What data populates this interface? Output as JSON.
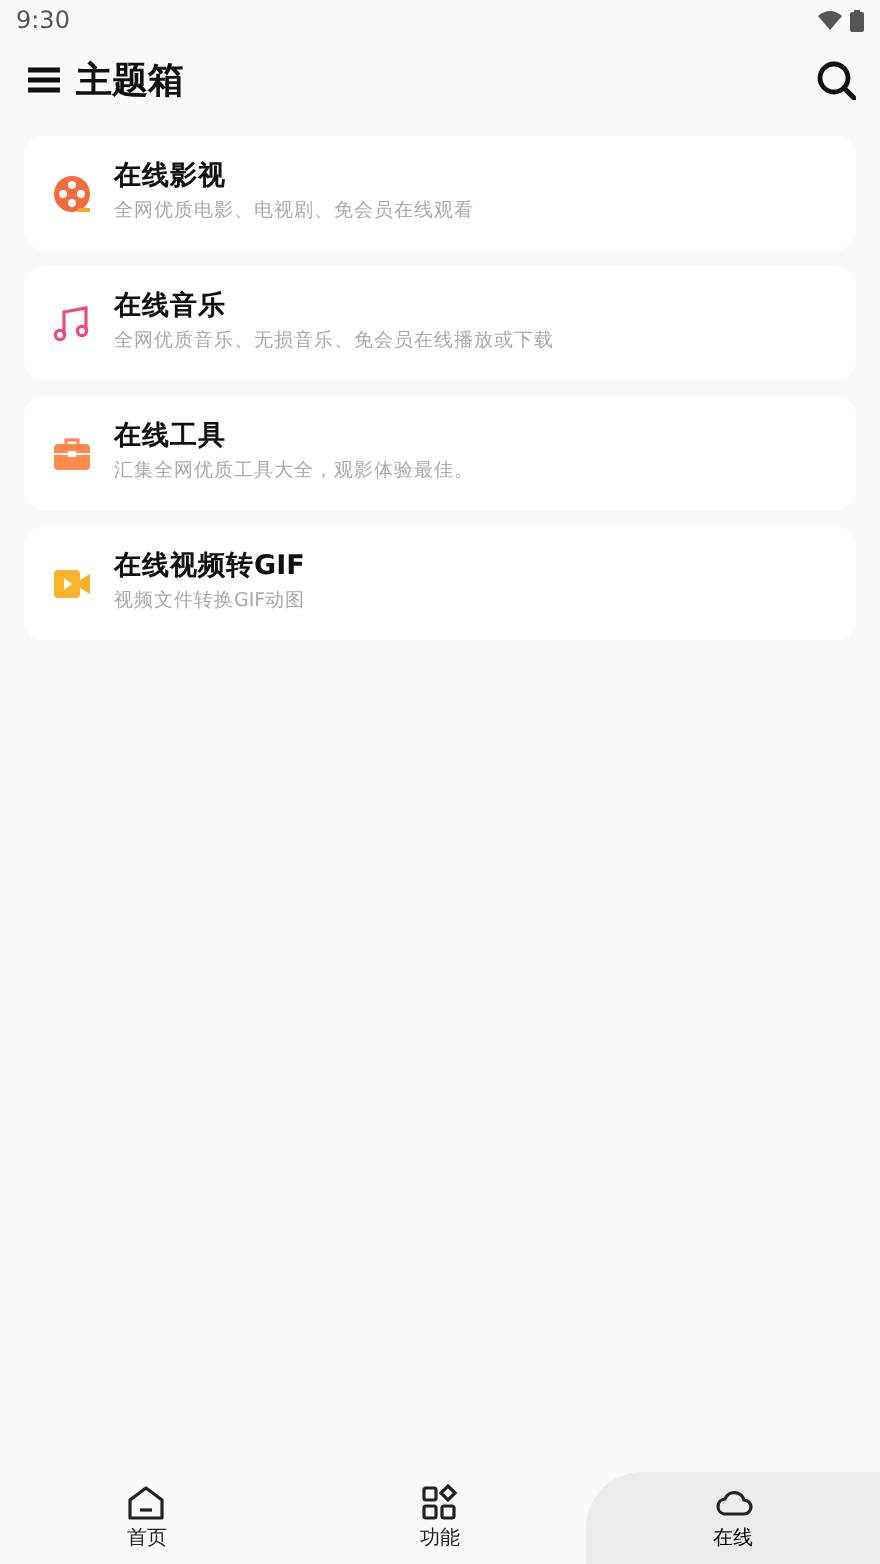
{
  "status_bar": {
    "time": "9:30"
  },
  "app_bar": {
    "title": "主题箱"
  },
  "items": [
    {
      "kind": "film",
      "title": "在线影视",
      "subtitle": "全网优质电影、电视剧、免会员在线观看"
    },
    {
      "kind": "music",
      "title": "在线音乐",
      "subtitle": "全网优质音乐、无损音乐、免会员在线播放或下载"
    },
    {
      "kind": "toolbox",
      "title": "在线工具",
      "subtitle": "汇集全网优质工具大全，观影体验最佳。"
    },
    {
      "kind": "video",
      "title": "在线视频转GIF",
      "subtitle": "视频文件转换GIF动图"
    }
  ],
  "bottom_nav": [
    {
      "kind": "home",
      "label": "首页",
      "selected": false
    },
    {
      "kind": "apps",
      "label": "功能",
      "selected": false
    },
    {
      "kind": "cloud",
      "label": "在线",
      "selected": true
    }
  ]
}
